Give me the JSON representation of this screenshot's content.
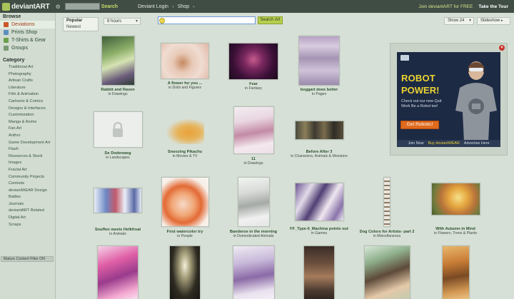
{
  "topbar": {
    "logo_text": "deviantART",
    "search_button": "Search",
    "links": [
      "Deviant Login",
      "Shop"
    ],
    "join": "Join deviantART for FREE",
    "tour": "Take the Tour"
  },
  "sidebar": {
    "browse_heading": "Browse",
    "browse_items": [
      {
        "label": "Deviations",
        "color": "#c9592b"
      },
      {
        "label": "Prints Shop",
        "color": "#5e8fc0"
      },
      {
        "label": "T-Shirts & Gear",
        "color": "#6aa14a"
      },
      {
        "label": "Groups",
        "color": "#7a9a72"
      }
    ],
    "category_heading": "Category",
    "categories": [
      "Traditional Art",
      "Photography",
      "Artisan Crafts",
      "Literature",
      "Film & Animation",
      "Cartoons & Comics",
      "Designs & Interfaces",
      "Customization",
      "Manga & Anime",
      "Fan Art",
      "Anthro",
      "Game Development Art",
      "Flash",
      "Resources & Stock Images",
      "Fractal Art",
      "Community Projects",
      "Contests",
      "deviantWEAR Design Battles",
      "Journals",
      "deviantART Related",
      "Digital Art",
      "Scraps"
    ],
    "mature_filter": "Mature Content Filter ON"
  },
  "toolbar": {
    "sort_selected": "Popular",
    "sort_other": "Newest",
    "time_range": "8 hours",
    "search_placeholder": "",
    "search_button": "Search Art",
    "show_count": "Show 24",
    "slideshow": "Slideshow"
  },
  "deviations": [
    {
      "title": "Rabbit and Raven",
      "category": "in Drawings"
    },
    {
      "title": "A flower for you ...",
      "category": "in Dolls and Figures"
    },
    {
      "title": "Fear",
      "category": "in Fantasy"
    },
    {
      "title": "boggart does better",
      "category": "in Pages"
    },
    {
      "title": "De Dodenweg",
      "category": "in Landscapes"
    },
    {
      "title": "Snoozing Pikachu",
      "category": "in Movies & TV"
    },
    {
      "title": "11",
      "category": "in Drawings"
    },
    {
      "title": "Before After 3",
      "category": "in Characters, Animals & Monsters"
    },
    {
      "title": "Snuffen meets Helkfroat",
      "category": "in Animals"
    },
    {
      "title": "First watercolor try",
      "category": "in People"
    },
    {
      "title": "Banderoe in the morning",
      "category": "in Domesticated Animals"
    },
    {
      "title": "FF_Type-0_Machina points out",
      "category": "in Games"
    },
    {
      "title": "Dog Colors for Artists- part 2",
      "category": "in Miscellaneous"
    },
    {
      "title": "With Autumn in Mind",
      "category": "in Flowers, Trees & Plants"
    }
  ],
  "ad": {
    "headline1": "ROBOT",
    "headline2": "POWER!",
    "sub": "Check out our new Quit Work Be a Robot tee!",
    "button": "Get Robotic!",
    "foot_join": "Join Now",
    "foot_buy": "Buy deviantWEAR",
    "foot_here": "Advertise Here"
  }
}
